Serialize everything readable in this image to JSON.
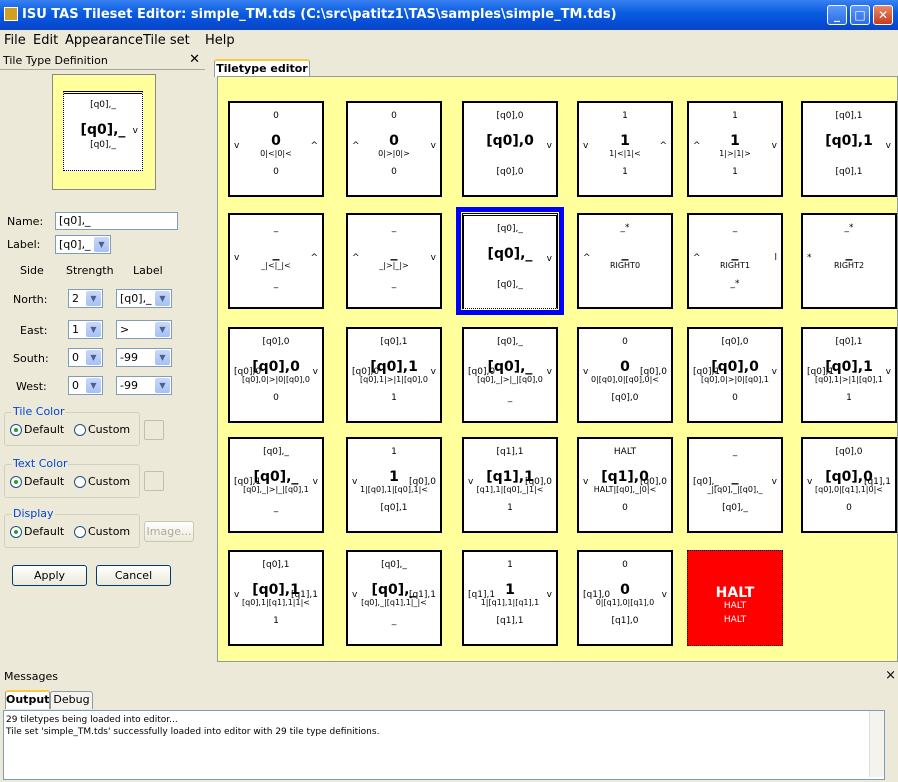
{
  "window": {
    "title": "ISU TAS Tileset Editor: simple_TM.tds (C:\\src\\patitz1\\TAS\\samples\\simple_TM.tds)",
    "min": "_",
    "max": "□",
    "close": "✕"
  },
  "menu": [
    "File",
    "Edit",
    "Appearance",
    "Tile set",
    "Help"
  ],
  "left_panel": {
    "title": "Tile Type Definition",
    "close": "✕",
    "preview": {
      "north": "[q0],_",
      "center": "[q0],_",
      "south": "[q0],_",
      "east": "v"
    },
    "name_label": "Name:",
    "name_value": "[q0],_",
    "label_label": "Label:",
    "label_value": "[q0],_",
    "headers": {
      "side": "Side",
      "strength": "Strength",
      "label": "Label"
    },
    "sides": [
      {
        "name": "North:",
        "strength": "2",
        "label": "[q0],_"
      },
      {
        "name": "East:",
        "strength": "1",
        "label": ">"
      },
      {
        "name": "South:",
        "strength": "0",
        "label": "-99"
      },
      {
        "name": "West:",
        "strength": "0",
        "label": "-99"
      }
    ],
    "tile_color": {
      "title": "Tile Color",
      "default": "Default",
      "custom": "Custom"
    },
    "text_color": {
      "title": "Text Color",
      "default": "Default",
      "custom": "Custom"
    },
    "display": {
      "title": "Display",
      "default": "Default",
      "custom": "Custom",
      "image": "Image..."
    },
    "apply": "Apply",
    "cancel": "Cancel"
  },
  "editor": {
    "tab": "Tiletype editor"
  },
  "tiles": [
    {
      "n": "0",
      "c": "0",
      "s": "0",
      "sub": "0|<|0|<",
      "e": "^",
      "w": "v"
    },
    {
      "n": "0",
      "c": "0",
      "s": "0",
      "sub": "0|>|0|>",
      "e": "v",
      "w": "^"
    },
    {
      "n": "[q0],0",
      "c": "[q0],0",
      "s": "[q0],0",
      "sub": "",
      "e": "v",
      "w": ""
    },
    {
      "n": "1",
      "c": "1",
      "s": "1",
      "sub": "1|<|1|<",
      "e": "^",
      "w": "v"
    },
    {
      "n": "1",
      "c": "1",
      "s": "1",
      "sub": "1|>|1|>",
      "e": "v",
      "w": "^"
    },
    {
      "n": "[q0],1",
      "c": "[q0],1",
      "s": "[q0],1",
      "sub": "",
      "e": "v",
      "w": ""
    },
    {
      "n": "_",
      "c": "_",
      "s": "_",
      "sub": "_|<|_|<",
      "e": "^",
      "w": "v"
    },
    {
      "n": "_",
      "c": "_",
      "s": "_",
      "sub": "_|>|_|>",
      "e": "v",
      "w": "^"
    },
    {
      "n": "[q0],_",
      "c": "[q0],_",
      "s": "[q0],_",
      "sub": "",
      "e": "v",
      "w": ""
    },
    {
      "n": "_*",
      "c": "_",
      "s": "",
      "sub": "RIGHT0",
      "e": "",
      "w": "^"
    },
    {
      "n": "_",
      "c": "_",
      "s": "_*",
      "sub": "RIGHT1",
      "e": "l",
      "w": "^"
    },
    {
      "n": "_*",
      "c": "_",
      "s": "",
      "sub": "RIGHT2",
      "e": "",
      "w": "*"
    },
    {
      "n": "[q0],0",
      "c": "[q0],0",
      "s": "0",
      "sub": "[q0],0|>|0|[q0],0",
      "e": "v",
      "w": "[q0],0"
    },
    {
      "n": "[q0],1",
      "c": "[q0],1",
      "s": "1",
      "sub": "[q0],1|>|1|[q0],0",
      "e": "v",
      "w": "[q0],0"
    },
    {
      "n": "[q0],_",
      "c": "[q0],_",
      "s": "_",
      "sub": "[q0],_|>|_|[q0],0",
      "e": "v",
      "w": "[q0],0"
    },
    {
      "n": "0",
      "c": "0",
      "s": "[q0],0",
      "sub": "0|[q0],0|[q0],0|<",
      "e": "[q0],0",
      "w": "v"
    },
    {
      "n": "[q0],0",
      "c": "[q0],0",
      "s": "0",
      "sub": "[q0],0|>|0|[q0],1",
      "e": "v",
      "w": "[q0],1"
    },
    {
      "n": "[q0],1",
      "c": "[q0],1",
      "s": "1",
      "sub": "[q0],1|>|1|[q0],1",
      "e": "v",
      "w": "[q0],1"
    },
    {
      "n": "[q0],_",
      "c": "[q0],_",
      "s": "_",
      "sub": "[q0],_|>|_|[q0],1",
      "e": "v",
      "w": "[q0],1"
    },
    {
      "n": "1",
      "c": "1",
      "s": "[q0],1",
      "sub": "1|[q0],1|[q0],1|<",
      "e": "[q0],0",
      "w": "v"
    },
    {
      "n": "[q1],1",
      "c": "[q1],1",
      "s": "1",
      "sub": "[q1],1|[q0],_|1|<",
      "e": "[q0],0",
      "w": "v"
    },
    {
      "n": "HALT",
      "c": "[q1],0",
      "s": "0",
      "sub": "HALT|[q0],_|0|<",
      "e": "[q0],0",
      "w": "v"
    },
    {
      "n": "_",
      "c": "_",
      "s": "[q0],_",
      "sub": "_|[q0],_|[q0],_",
      "e": "v",
      "w": "[q0],_"
    },
    {
      "n": "[q0],0",
      "c": "[q0],0",
      "s": "0",
      "sub": "[q0],0|[q1],1|0|<",
      "e": "[q1],1",
      "w": "v"
    },
    {
      "n": "[q0],1",
      "c": "[q0],1",
      "s": "1",
      "sub": "[q0],1|[q1],1|1|<",
      "e": "[q1],1",
      "w": "v"
    },
    {
      "n": "[q0],_",
      "c": "[q0],_",
      "s": "_",
      "sub": "[q0],_|[q1],1|_|<",
      "e": "[q1],1",
      "w": "v"
    },
    {
      "n": "1",
      "c": "1",
      "s": "[q1],1",
      "sub": "1|[q1],1|[q1],1",
      "e": "v",
      "w": "[q1],1"
    },
    {
      "n": "0",
      "c": "0",
      "s": "[q1],0",
      "sub": "0|[q1],0|[q1],0",
      "e": "v",
      "w": "[q1],0"
    },
    {
      "n": "",
      "c": "HALT",
      "s": "HALT",
      "sub": "HALT",
      "e": "",
      "w": "",
      "red": true
    }
  ],
  "messages": {
    "title": "Messages",
    "close": "×",
    "tabs": [
      "Output",
      "Debug"
    ],
    "lines": [
      "29 tiletypes being loaded into editor...",
      "Tile set 'simple_TM.tds' successfully loaded into editor with 29 tile type definitions."
    ]
  },
  "colors": {
    "title_bar": "#0a5fe0",
    "canvas_bg": "#ffff9c",
    "selected_border": "#0000ff",
    "halt_tile": "#ff0000"
  }
}
